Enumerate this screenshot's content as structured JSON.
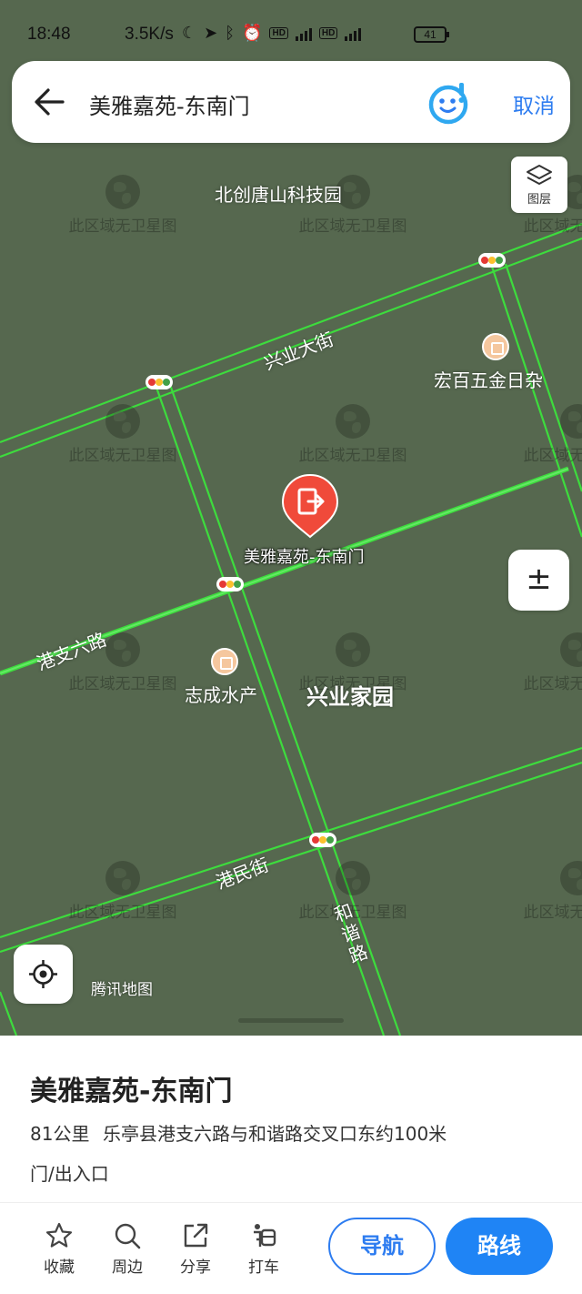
{
  "status": {
    "time": "18:48",
    "speed": "3.5K/s",
    "battery": "41"
  },
  "search": {
    "title": "美雅嘉苑-东南门",
    "cancel": "取消"
  },
  "map": {
    "layers_label": "图层",
    "watermark": "此区域无卫星图",
    "provider": "腾讯地图",
    "zoom_glyph": "±",
    "labels": {
      "park": "北创唐山科技园",
      "street1": "兴业大街",
      "shop1": "宏百五金日杂",
      "road2": "港支六路",
      "shop2": "志成水产",
      "area": "兴业家园",
      "street3": "港民街",
      "road4": "和谐路"
    },
    "marker_label": "美雅嘉苑-东南门",
    "road_color": "#3ddc3d"
  },
  "place": {
    "name": "美雅嘉苑-东南门",
    "distance": "81公里",
    "address": "乐亭县港支六路与和谐路交叉口东约100米",
    "type": "门/出入口"
  },
  "actions": {
    "favorite": "收藏",
    "nearby": "周边",
    "share": "分享",
    "taxi": "打车",
    "navigate": "导航",
    "route": "路线"
  },
  "colors": {
    "accent": "#1f84f5",
    "marker": "#f04a3a"
  }
}
